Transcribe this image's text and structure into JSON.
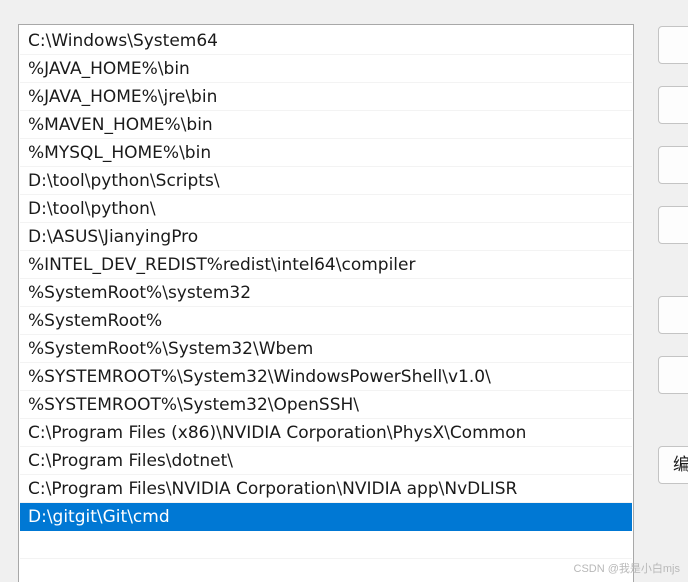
{
  "path_list": {
    "items": [
      "C:\\Windows\\System64",
      "%JAVA_HOME%\\bin",
      "%JAVA_HOME%\\jre\\bin",
      "%MAVEN_HOME%\\bin",
      "%MYSQL_HOME%\\bin",
      "D:\\tool\\python\\Scripts\\",
      "D:\\tool\\python\\",
      "D:\\ASUS\\JianyingPro",
      "%INTEL_DEV_REDIST%redist\\intel64\\compiler",
      "%SystemRoot%\\system32",
      "%SystemRoot%",
      "%SystemRoot%\\System32\\Wbem",
      "%SYSTEMROOT%\\System32\\WindowsPowerShell\\v1.0\\",
      "%SYSTEMROOT%\\System32\\OpenSSH\\",
      "C:\\Program Files (x86)\\NVIDIA Corporation\\PhysX\\Common",
      "C:\\Program Files\\dotnet\\",
      "C:\\Program Files\\NVIDIA Corporation\\NVIDIA app\\NvDLISR",
      "D:\\gitgit\\Git\\cmd"
    ],
    "selected_index": 17
  },
  "side_buttons": {
    "edit_text_label": "编"
  },
  "watermark": "CSDN @我是小白mjs",
  "colors": {
    "selection": "#0078d4"
  }
}
